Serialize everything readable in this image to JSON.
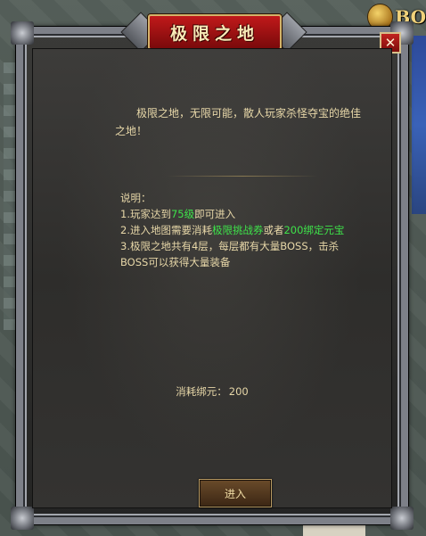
{
  "hud": {
    "boss_label": "BO"
  },
  "dialog": {
    "title": "极限之地",
    "close_symbol": "✕",
    "intro": "极限之地，无限可能，散人玩家杀怪夺宝的绝佳之地！",
    "notes_heading": "说明：",
    "notes": [
      {
        "prefix": "1.玩家达到",
        "hl": "75级",
        "suffix": "即可进入"
      },
      {
        "prefix": "2.进入地图需要消耗",
        "hl": "极限挑战券",
        "mid": "或者",
        "hl2": "200绑定元宝",
        "suffix": ""
      },
      {
        "text": "3.极限之地共有4层，每层都有大量BOSS，击杀BOSS可以获得大量装备"
      }
    ],
    "cost_label": "消耗绑元：",
    "cost_value": "200",
    "enter_button": "进入"
  },
  "colors": {
    "text": "#e7d7a8",
    "highlight": "#3ee34a",
    "title_bg": "#c0191a"
  }
}
